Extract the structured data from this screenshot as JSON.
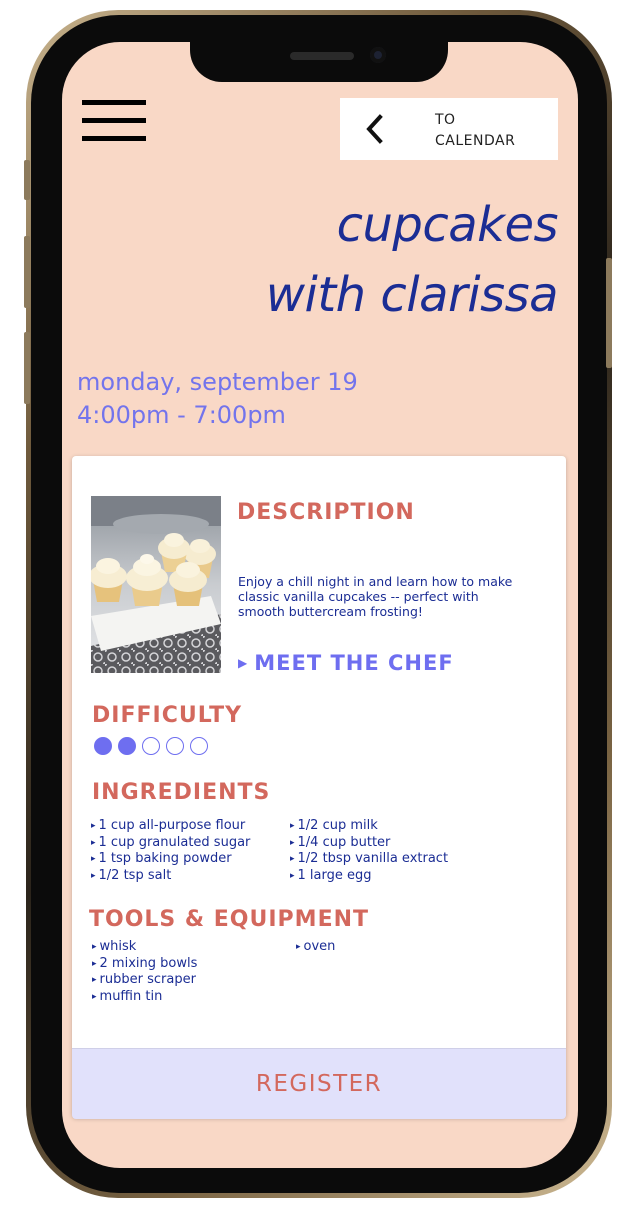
{
  "header": {
    "menu_icon": "hamburger-menu-icon",
    "back_icon": "chevron-left-icon",
    "back_label_line1": "TO",
    "back_label_line2": "CALENDAR"
  },
  "event": {
    "title_line1": "cupcakes",
    "title_line2": "with clarissa",
    "date": "monday, september 19",
    "time": "4:00pm - 7:00pm"
  },
  "description": {
    "heading": "DESCRIPTION",
    "text": "Enjoy a chill night in and learn how to make classic vanilla cupcakes -- perfect with smooth buttercream frosting!",
    "chef_link": "MEET THE CHEF"
  },
  "difficulty": {
    "heading": "DIFFICULTY",
    "level": 2,
    "max": 5
  },
  "ingredients": {
    "heading": "INGREDIENTS",
    "col1": [
      "1 cup all-purpose flour",
      "1 cup granulated sugar",
      "1 tsp baking powder",
      "1/2 tsp salt"
    ],
    "col2": [
      "1/2 cup milk",
      "1/4 cup butter",
      "1/2 tbsp vanilla extract",
      "1 large egg"
    ]
  },
  "tools": {
    "heading": "TOOLS & EQUIPMENT",
    "col1": [
      "whisk",
      "2 mixing bowls",
      "rubber scraper",
      "muffin tin"
    ],
    "col2": [
      "oven"
    ]
  },
  "register_label": "REGISTER",
  "colors": {
    "background": "#f9d8c6",
    "title": "#1b2d94",
    "accent": "#6e6ef0",
    "heading": "#d3685d",
    "register_bg": "#e1e1fb"
  }
}
